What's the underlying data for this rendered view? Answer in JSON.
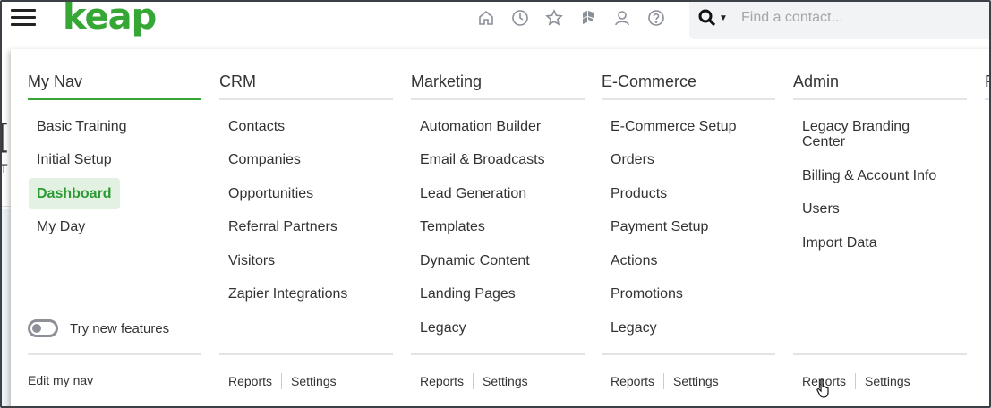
{
  "header": {
    "logo": "keap",
    "search": {
      "placeholder": "Find a contact..."
    }
  },
  "background": {
    "letter1": "[",
    "letter2": "T"
  },
  "columns": [
    {
      "heading": "My Nav",
      "items": [
        "Basic Training",
        "Initial Setup",
        "Dashboard",
        "My Day"
      ],
      "active_item": "Dashboard",
      "toggle_label": "Try new features",
      "footer": {
        "edit": "Edit my nav"
      }
    },
    {
      "heading": "CRM",
      "items": [
        "Contacts",
        "Companies",
        "Opportunities",
        "Referral Partners",
        "Visitors",
        "Zapier Integrations"
      ],
      "footer": {
        "reports": "Reports",
        "settings": "Settings"
      }
    },
    {
      "heading": "Marketing",
      "items": [
        "Automation Builder",
        "Email & Broadcasts",
        "Lead Generation",
        "Templates",
        "Dynamic Content",
        "Landing Pages",
        "Legacy"
      ],
      "footer": {
        "reports": "Reports",
        "settings": "Settings"
      }
    },
    {
      "heading": "E-Commerce",
      "items": [
        "E-Commerce Setup",
        "Orders",
        "Products",
        "Payment Setup",
        "Actions",
        "Promotions",
        "Legacy"
      ],
      "footer": {
        "reports": "Reports",
        "settings": "Settings"
      }
    },
    {
      "heading": "Admin",
      "items": [
        "Legacy Branding\nCenter",
        "Billing & Account Info",
        "Users",
        "Import Data"
      ],
      "footer": {
        "reports": "Reports",
        "settings": "Settings"
      }
    },
    {
      "heading": "R"
    }
  ],
  "colors": {
    "brand": "#36a635",
    "active_bg": "#e2f1e1",
    "rule": "#e3e4e6"
  }
}
